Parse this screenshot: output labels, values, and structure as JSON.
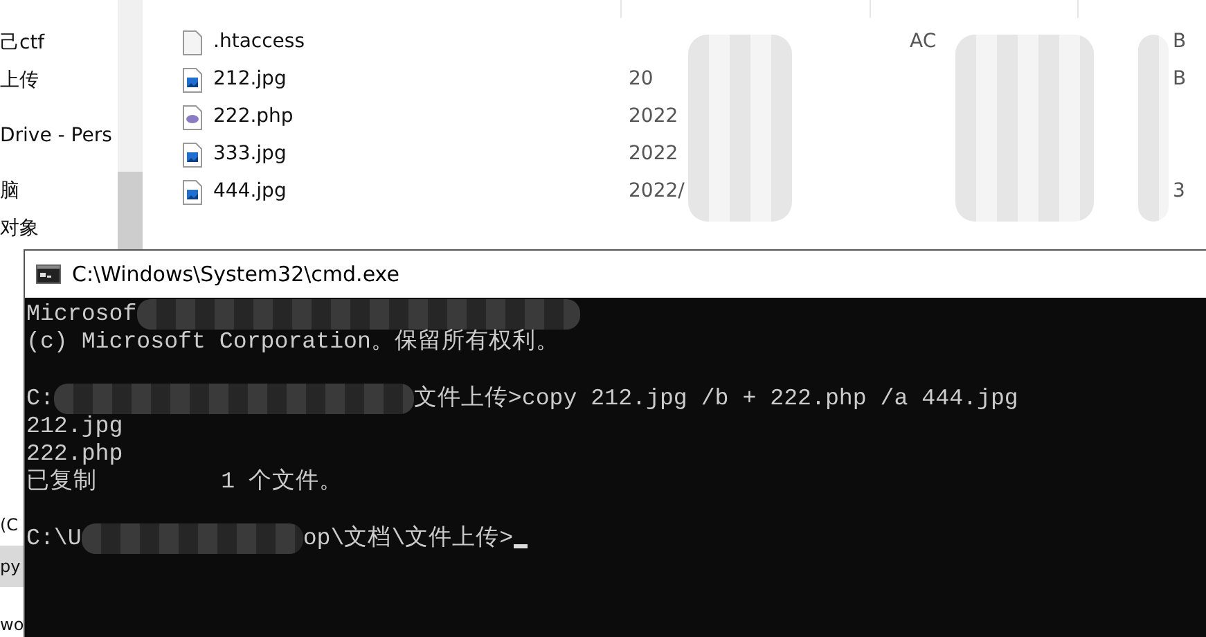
{
  "explorer": {
    "nav_items": [
      {
        "label": "己ctf",
        "selected": false
      },
      {
        "label": "上传",
        "selected": false
      },
      {
        "label": "Drive - Pers",
        "selected": false
      },
      {
        "label": "脑",
        "selected": false
      },
      {
        "label": "对象",
        "selected": false
      }
    ],
    "nav_items_behind": [
      {
        "label": "(C",
        "selected": false
      },
      {
        "label": "py",
        "selected": true
      },
      {
        "label": "wo",
        "selected": false
      }
    ],
    "files": [
      {
        "name": ".htaccess",
        "kind": "blank",
        "type": "AC",
        "size": "B"
      },
      {
        "name": "212.jpg",
        "kind": "image",
        "date": "20",
        "size": "B"
      },
      {
        "name": "222.php",
        "kind": "php",
        "date": "2022"
      },
      {
        "name": "333.jpg",
        "kind": "image",
        "date": "2022"
      },
      {
        "name": "444.jpg",
        "kind": "image",
        "date": "2022/",
        "size": "3"
      }
    ]
  },
  "console": {
    "title": "C:\\Windows\\System32\\cmd.exe",
    "lines": [
      {
        "kind": "text",
        "segments": [
          {
            "kind": "text",
            "text": "Microsof"
          },
          {
            "kind": "redacted"
          }
        ]
      },
      {
        "kind": "text",
        "segments": [
          {
            "kind": "text",
            "text": "(c) Microsoft Corporation。保留所有权利。"
          }
        ]
      },
      {
        "kind": "blank"
      },
      {
        "kind": "text",
        "segments": [
          {
            "kind": "text",
            "text": "C:"
          },
          {
            "kind": "redacted"
          },
          {
            "kind": "text",
            "text": "文件上传>copy 212.jpg /b + 222.php /a 444.jpg"
          }
        ]
      },
      {
        "kind": "text",
        "segments": [
          {
            "kind": "text",
            "text": "212.jpg"
          }
        ]
      },
      {
        "kind": "text",
        "segments": [
          {
            "kind": "text",
            "text": "222.php"
          }
        ]
      },
      {
        "kind": "text",
        "segments": [
          {
            "kind": "text",
            "text": "已复制         1 个文件。"
          }
        ]
      },
      {
        "kind": "blank"
      },
      {
        "kind": "text",
        "segments": [
          {
            "kind": "text",
            "text": "C:\\U"
          },
          {
            "kind": "redacted"
          },
          {
            "kind": "text",
            "text": "op\\文档\\文件上传>"
          },
          {
            "kind": "cursor"
          }
        ]
      }
    ]
  }
}
